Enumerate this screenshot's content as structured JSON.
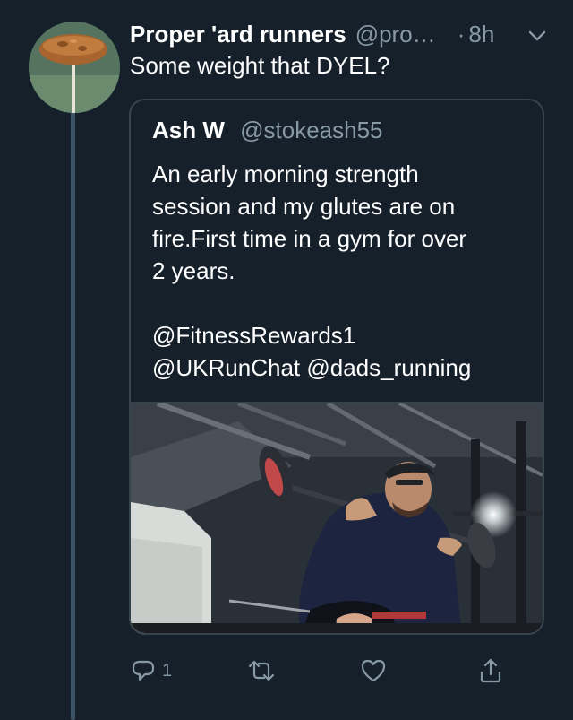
{
  "tweet": {
    "display_name": "Proper 'ard runners",
    "handle": "@pro…",
    "separator": "·",
    "time": "8h",
    "text": "Some weight that DYEL?"
  },
  "quoted_tweet": {
    "display_name": "Ash W",
    "handle": "@stokeash55",
    "text_lines": [
      "An early morning strength",
      "session and my glutes are on",
      "fire.First time in a gym for over",
      "2 years."
    ],
    "mention_lines": [
      "@FitnessRewards1",
      "@UKRunChat @dads_running"
    ]
  },
  "actions": {
    "reply_count": "1"
  },
  "icons": {
    "caret": "chevron-down-icon",
    "reply": "reply-icon",
    "retweet": "retweet-icon",
    "like": "heart-icon",
    "share": "share-icon"
  },
  "colors": {
    "background": "#15202b",
    "secondary_text": "#8899a6",
    "border": "#38444d",
    "thread_line": "#3d5466"
  }
}
